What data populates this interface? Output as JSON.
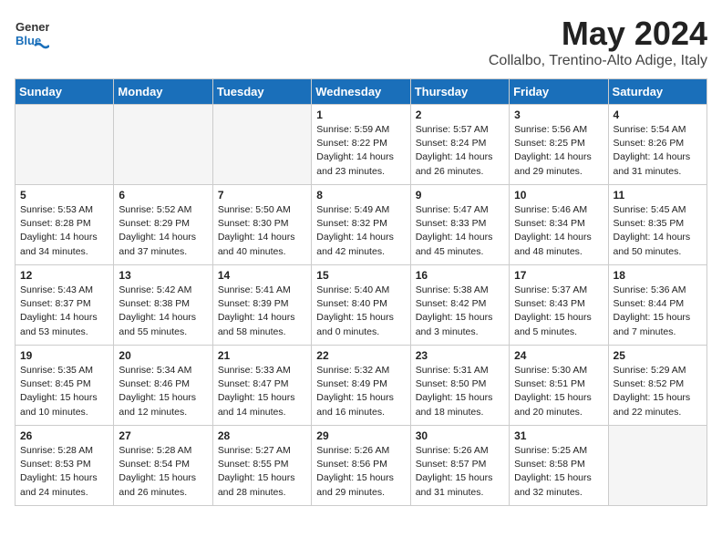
{
  "logo": {
    "general": "General",
    "blue": "Blue"
  },
  "title": "May 2024",
  "location": "Collalbo, Trentino-Alto Adige, Italy",
  "days_of_week": [
    "Sunday",
    "Monday",
    "Tuesday",
    "Wednesday",
    "Thursday",
    "Friday",
    "Saturday"
  ],
  "weeks": [
    [
      {
        "day": "",
        "empty": true
      },
      {
        "day": "",
        "empty": true
      },
      {
        "day": "",
        "empty": true
      },
      {
        "day": "1",
        "info": "Sunrise: 5:59 AM\nSunset: 8:22 PM\nDaylight: 14 hours\nand 23 minutes."
      },
      {
        "day": "2",
        "info": "Sunrise: 5:57 AM\nSunset: 8:24 PM\nDaylight: 14 hours\nand 26 minutes."
      },
      {
        "day": "3",
        "info": "Sunrise: 5:56 AM\nSunset: 8:25 PM\nDaylight: 14 hours\nand 29 minutes."
      },
      {
        "day": "4",
        "info": "Sunrise: 5:54 AM\nSunset: 8:26 PM\nDaylight: 14 hours\nand 31 minutes."
      }
    ],
    [
      {
        "day": "5",
        "info": "Sunrise: 5:53 AM\nSunset: 8:28 PM\nDaylight: 14 hours\nand 34 minutes."
      },
      {
        "day": "6",
        "info": "Sunrise: 5:52 AM\nSunset: 8:29 PM\nDaylight: 14 hours\nand 37 minutes."
      },
      {
        "day": "7",
        "info": "Sunrise: 5:50 AM\nSunset: 8:30 PM\nDaylight: 14 hours\nand 40 minutes."
      },
      {
        "day": "8",
        "info": "Sunrise: 5:49 AM\nSunset: 8:32 PM\nDaylight: 14 hours\nand 42 minutes."
      },
      {
        "day": "9",
        "info": "Sunrise: 5:47 AM\nSunset: 8:33 PM\nDaylight: 14 hours\nand 45 minutes."
      },
      {
        "day": "10",
        "info": "Sunrise: 5:46 AM\nSunset: 8:34 PM\nDaylight: 14 hours\nand 48 minutes."
      },
      {
        "day": "11",
        "info": "Sunrise: 5:45 AM\nSunset: 8:35 PM\nDaylight: 14 hours\nand 50 minutes."
      }
    ],
    [
      {
        "day": "12",
        "info": "Sunrise: 5:43 AM\nSunset: 8:37 PM\nDaylight: 14 hours\nand 53 minutes."
      },
      {
        "day": "13",
        "info": "Sunrise: 5:42 AM\nSunset: 8:38 PM\nDaylight: 14 hours\nand 55 minutes."
      },
      {
        "day": "14",
        "info": "Sunrise: 5:41 AM\nSunset: 8:39 PM\nDaylight: 14 hours\nand 58 minutes."
      },
      {
        "day": "15",
        "info": "Sunrise: 5:40 AM\nSunset: 8:40 PM\nDaylight: 15 hours\nand 0 minutes."
      },
      {
        "day": "16",
        "info": "Sunrise: 5:38 AM\nSunset: 8:42 PM\nDaylight: 15 hours\nand 3 minutes."
      },
      {
        "day": "17",
        "info": "Sunrise: 5:37 AM\nSunset: 8:43 PM\nDaylight: 15 hours\nand 5 minutes."
      },
      {
        "day": "18",
        "info": "Sunrise: 5:36 AM\nSunset: 8:44 PM\nDaylight: 15 hours\nand 7 minutes."
      }
    ],
    [
      {
        "day": "19",
        "info": "Sunrise: 5:35 AM\nSunset: 8:45 PM\nDaylight: 15 hours\nand 10 minutes."
      },
      {
        "day": "20",
        "info": "Sunrise: 5:34 AM\nSunset: 8:46 PM\nDaylight: 15 hours\nand 12 minutes."
      },
      {
        "day": "21",
        "info": "Sunrise: 5:33 AM\nSunset: 8:47 PM\nDaylight: 15 hours\nand 14 minutes."
      },
      {
        "day": "22",
        "info": "Sunrise: 5:32 AM\nSunset: 8:49 PM\nDaylight: 15 hours\nand 16 minutes."
      },
      {
        "day": "23",
        "info": "Sunrise: 5:31 AM\nSunset: 8:50 PM\nDaylight: 15 hours\nand 18 minutes."
      },
      {
        "day": "24",
        "info": "Sunrise: 5:30 AM\nSunset: 8:51 PM\nDaylight: 15 hours\nand 20 minutes."
      },
      {
        "day": "25",
        "info": "Sunrise: 5:29 AM\nSunset: 8:52 PM\nDaylight: 15 hours\nand 22 minutes."
      }
    ],
    [
      {
        "day": "26",
        "info": "Sunrise: 5:28 AM\nSunset: 8:53 PM\nDaylight: 15 hours\nand 24 minutes."
      },
      {
        "day": "27",
        "info": "Sunrise: 5:28 AM\nSunset: 8:54 PM\nDaylight: 15 hours\nand 26 minutes."
      },
      {
        "day": "28",
        "info": "Sunrise: 5:27 AM\nSunset: 8:55 PM\nDaylight: 15 hours\nand 28 minutes."
      },
      {
        "day": "29",
        "info": "Sunrise: 5:26 AM\nSunset: 8:56 PM\nDaylight: 15 hours\nand 29 minutes."
      },
      {
        "day": "30",
        "info": "Sunrise: 5:26 AM\nSunset: 8:57 PM\nDaylight: 15 hours\nand 31 minutes."
      },
      {
        "day": "31",
        "info": "Sunrise: 5:25 AM\nSunset: 8:58 PM\nDaylight: 15 hours\nand 32 minutes."
      },
      {
        "day": "",
        "empty": true
      }
    ]
  ]
}
